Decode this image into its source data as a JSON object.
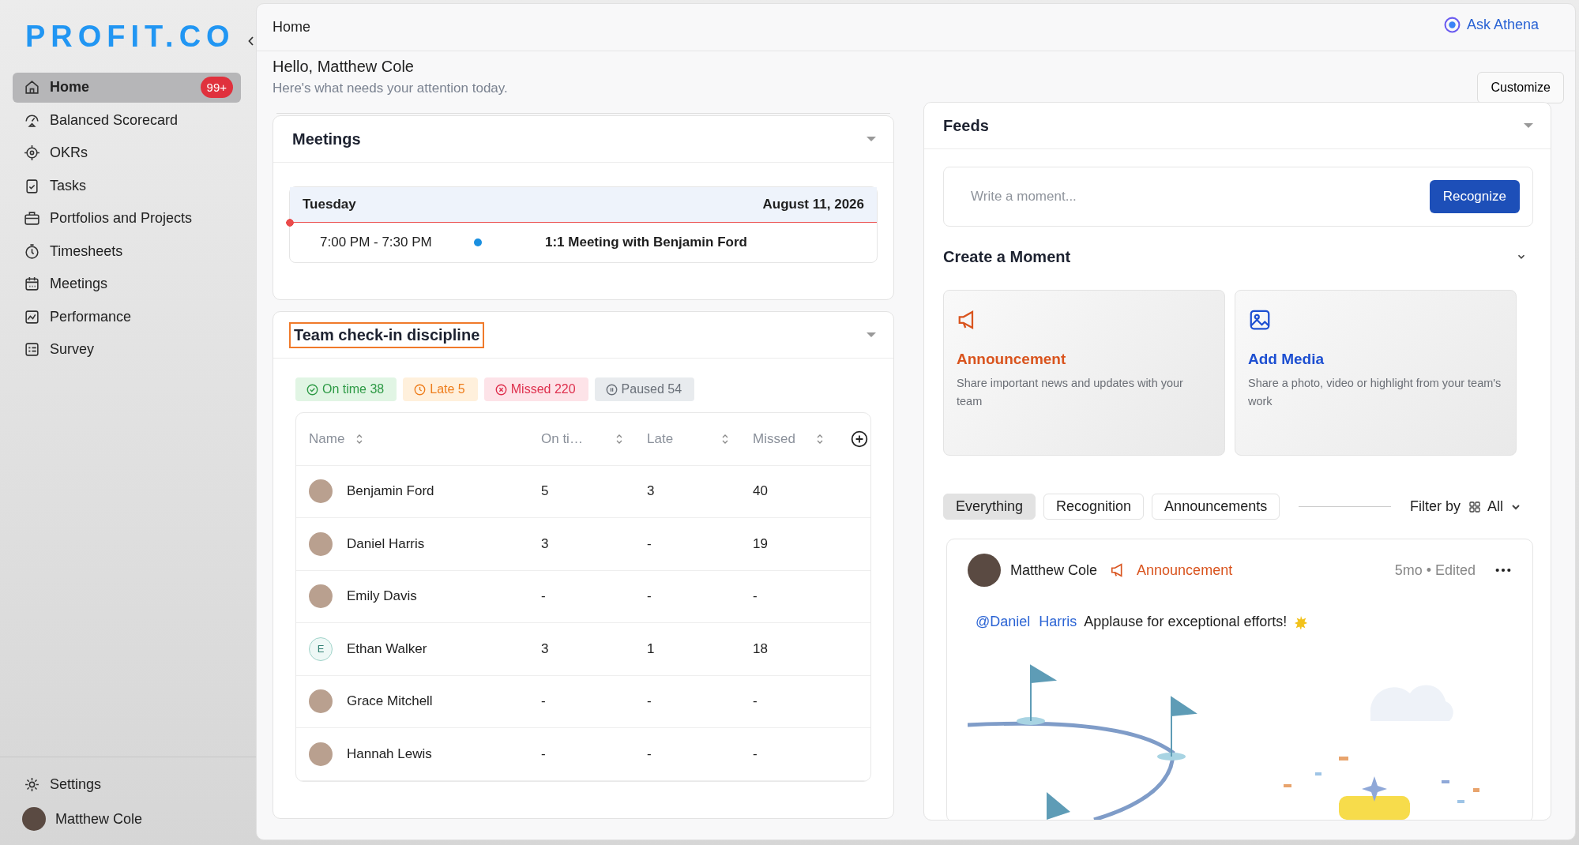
{
  "sidebar": {
    "logo": "PROFIT.CO",
    "items": [
      {
        "label": "Home",
        "selected": true,
        "badge": "99+"
      },
      {
        "label": "Balanced Scorecard",
        "selected": false
      },
      {
        "label": "OKRs",
        "selected": false
      },
      {
        "label": "Tasks",
        "selected": false
      },
      {
        "label": "Portfolios and Projects",
        "selected": false
      },
      {
        "label": "Timesheets",
        "selected": false
      },
      {
        "label": "Meetings",
        "selected": false
      },
      {
        "label": "Performance",
        "selected": false
      },
      {
        "label": "Survey",
        "selected": false
      }
    ],
    "settings": "Settings",
    "user": "Matthew Cole"
  },
  "header": {
    "breadcrumb": "Home",
    "assistant": "Ask Athena"
  },
  "greeting": {
    "title": "Hello, Matthew Cole",
    "subtitle": "Here's what needs your attention today.",
    "button": "Customize"
  },
  "meetings": {
    "title": "Meetings",
    "day": "Tuesday",
    "date": "August 11, 2026",
    "events": [
      {
        "time": "7:00 PM - 7:30 PM",
        "title": "1:1 Meeting with Benjamin Ford",
        "color": "#1a8fe0"
      }
    ]
  },
  "checkins": {
    "title": "Team check-in discipline",
    "chips": [
      {
        "kind": "on_time",
        "label": "On time 38"
      },
      {
        "kind": "late",
        "label": "Late 5"
      },
      {
        "kind": "missed",
        "label": "Missed 220"
      },
      {
        "kind": "paused",
        "label": "Paused 54"
      }
    ],
    "columns": [
      "Name",
      "On ti…",
      "Late",
      "Missed"
    ],
    "rows": [
      {
        "kind": "photo",
        "cells": [
          "Benjamin Ford",
          "5",
          "3",
          "40"
        ]
      },
      {
        "kind": "photo",
        "cells": [
          "Daniel Harris",
          "3",
          "-",
          "19"
        ]
      },
      {
        "kind": "photo",
        "cells": [
          "Emily Davis",
          "-",
          "-",
          "-"
        ]
      },
      {
        "kind": "initial",
        "initial": "E",
        "cells": [
          "Ethan Walker",
          "3",
          "1",
          "18"
        ]
      },
      {
        "kind": "photo",
        "cells": [
          "Grace Mitchell",
          "-",
          "-",
          "-"
        ]
      },
      {
        "kind": "photo",
        "cells": [
          "Hannah Lewis",
          "-",
          "-",
          "-"
        ]
      }
    ]
  },
  "feeds": {
    "title": "Feeds",
    "composer": {
      "placeholder": "Write a moment...",
      "button": "Recognize"
    },
    "create_title": "Create a Moment",
    "tiles": [
      {
        "kind": "announcement",
        "title": "Announcement",
        "text": "Share important news and updates with your team"
      },
      {
        "kind": "media",
        "title": "Add Media",
        "text": "Share a photo, video or highlight from your team's work"
      }
    ],
    "tabs": [
      {
        "label": "Everything",
        "selected": true
      },
      {
        "label": "Recognition",
        "selected": false
      },
      {
        "label": "Announcements",
        "selected": false
      }
    ],
    "filter": {
      "label": "Filter by",
      "value": "All"
    },
    "post": {
      "author": "Matthew Cole",
      "kind": "announcement",
      "type_label": "Announcement",
      "meta": "5mo • Edited",
      "mention": "@Daniel Harris",
      "text": "Applause for exceptional efforts!"
    }
  }
}
